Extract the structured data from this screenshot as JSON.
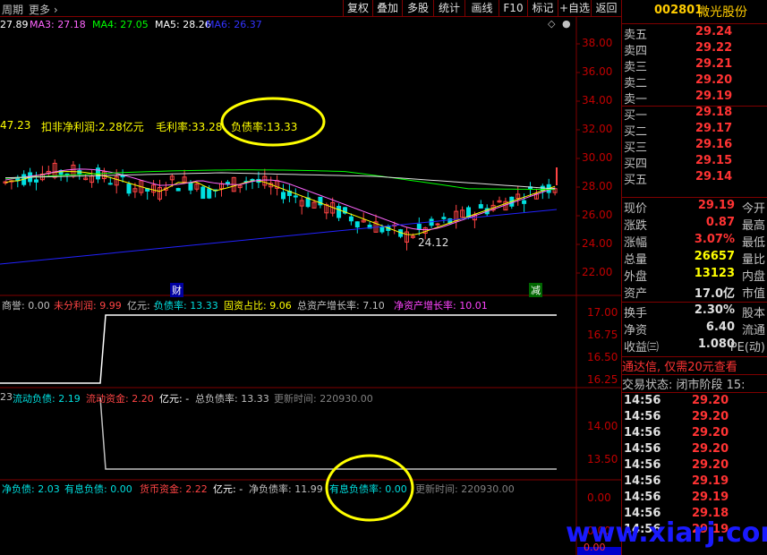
{
  "toolbar": {
    "left_text": "周期",
    "more": "更多",
    "buttons": [
      "复权",
      "叠加",
      "多股",
      "统计",
      "画线",
      "F10",
      "标记",
      "+自选",
      "返回"
    ]
  },
  "stock": {
    "code": "002801",
    "name": "微光股份"
  },
  "ma": [
    {
      "label": "27.89",
      "color": "#ffffff"
    },
    {
      "label": "MA3: 27.18",
      "color": "#ff66ff"
    },
    {
      "label": "MA4: 27.05",
      "color": "#00ff00"
    },
    {
      "label": "MA5: 28.26",
      "color": "#ffffff"
    },
    {
      "label": "MA6: 26.37",
      "color": "#3333ff"
    }
  ],
  "main_info": {
    "value": "47.23",
    "profit": "扣非净利润:2.28亿元",
    "gross": "毛利率:33.28",
    "debt": "负债率:13.33"
  },
  "price_axis": [
    "38.00",
    "36.00",
    "34.00",
    "32.00",
    "30.00",
    "28.00",
    "26.00",
    "24.00",
    "22.00"
  ],
  "low_label": "24.12",
  "markers": {
    "cai": "财",
    "jian": "减"
  },
  "ind1": {
    "items": [
      {
        "text": "商誉: 0.00",
        "color": "#c0c0c0"
      },
      {
        "text": "未分利润: 9.99",
        "color": "#ff4444"
      },
      {
        "text": "亿元: -",
        "color": "#c0c0c0"
      },
      {
        "text": "负债率: 13.33",
        "color": "#00e0e0"
      },
      {
        "text": "固资占比: 9.06",
        "color": "#ffff00"
      },
      {
        "text": "总资产增长率: 7.10",
        "color": "#c0c0c0"
      },
      {
        "text": "净资产增长率: 10.01",
        "color": "#ff44ff"
      }
    ],
    "axis": [
      "17.00",
      "16.75",
      "16.50",
      "16.25"
    ]
  },
  "ind2": {
    "items": [
      {
        "text": "23",
        "color": "#c0c0c0"
      },
      {
        "text": "流动负债: 2.19",
        "color": "#00e0e0"
      },
      {
        "text": "流动资金: 2.20",
        "color": "#ff4444"
      },
      {
        "text": "亿元: -",
        "color": "#ffffff"
      },
      {
        "text": "总负债率: 13.33",
        "color": "#c0c0c0"
      },
      {
        "text": "更新时间: 220930.00",
        "color": "#808080"
      }
    ],
    "axis": [
      "14.00",
      "13.50"
    ]
  },
  "ind3": {
    "items": [
      {
        "text": "净负债: 2.03",
        "color": "#00e0e0"
      },
      {
        "text": "有息负债: 0.00",
        "color": "#00e0e0"
      },
      {
        "text": "货币资金: 2.22",
        "color": "#ff4444"
      },
      {
        "text": "亿元: -",
        "color": "#ffffff"
      },
      {
        "text": "净负债率: 11.99",
        "color": "#c0c0c0"
      },
      {
        "text": "有息负债率: 0.00",
        "color": "#00e0e0"
      },
      {
        "text": "更新时间: 220930.00",
        "color": "#808080"
      }
    ],
    "axis": [
      "0.00",
      "0.00"
    ]
  },
  "orderbook": [
    {
      "label": "卖五",
      "price": "29.24"
    },
    {
      "label": "卖四",
      "price": "29.22"
    },
    {
      "label": "卖三",
      "price": "29.21"
    },
    {
      "label": "卖二",
      "price": "29.20"
    },
    {
      "label": "卖一",
      "price": "29.19"
    },
    {
      "label": "买一",
      "price": "29.18"
    },
    {
      "label": "买二",
      "price": "29.17"
    },
    {
      "label": "买三",
      "price": "29.16"
    },
    {
      "label": "买四",
      "price": "29.15"
    },
    {
      "label": "买五",
      "price": "29.14"
    }
  ],
  "quote": [
    {
      "label": "现价",
      "value": "29.19",
      "label2": "今开",
      "vcolor": "red"
    },
    {
      "label": "涨跌",
      "value": "0.87",
      "label2": "最高",
      "vcolor": "red"
    },
    {
      "label": "涨幅",
      "value": "3.07%",
      "label2": "最低",
      "vcolor": "red"
    },
    {
      "label": "总量",
      "value": "26657",
      "label2": "量比",
      "vcolor": "yel"
    },
    {
      "label": "外盘",
      "value": "13123",
      "label2": "内盘",
      "vcolor": "yel"
    },
    {
      "label": "资产",
      "value": "17.0亿",
      "label2": "市值",
      "vcolor": "wht"
    }
  ],
  "quote2": [
    {
      "label": "换手",
      "value": "2.30%",
      "label2": "股本"
    },
    {
      "label": "净资",
      "value": "6.40",
      "label2": "流通"
    },
    {
      "label": "收益㈢",
      "value": "1.080",
      "label2": "PE(动)"
    }
  ],
  "ad_text": "通达信, 仅需20元查看",
  "trade_state": "交易状态: 闭市阶段 15:",
  "trades": [
    {
      "time": "14:56",
      "price": "29.20"
    },
    {
      "time": "14:56",
      "price": "29.20"
    },
    {
      "time": "14:56",
      "price": "29.20"
    },
    {
      "time": "14:56",
      "price": "29.20"
    },
    {
      "time": "14:56",
      "price": "29.20"
    },
    {
      "time": "14:56",
      "price": "29.19"
    },
    {
      "time": "14:56",
      "price": "29.19"
    },
    {
      "time": "14:56",
      "price": "29.18"
    },
    {
      "time": "14:56",
      "price": "29.19"
    }
  ],
  "bottom_axis_label": "0.00",
  "watermark": "www.xiarj.com"
}
